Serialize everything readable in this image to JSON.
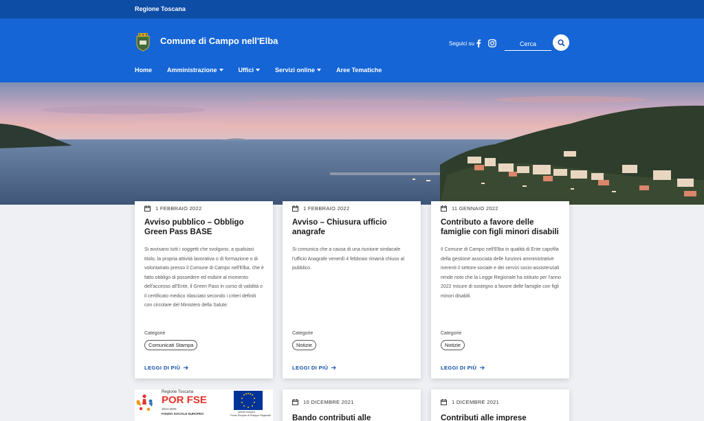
{
  "topbar": {
    "region": "Regione Toscana"
  },
  "header": {
    "title": "Comune di Campo nell'Elba",
    "follow_label": "Seguici su",
    "search_placeholder": "Cerca"
  },
  "nav": [
    {
      "label": "Home",
      "dropdown": false
    },
    {
      "label": "Amministrazione",
      "dropdown": true
    },
    {
      "label": "Uffici",
      "dropdown": true
    },
    {
      "label": "Servizi online",
      "dropdown": true
    },
    {
      "label": "Aree Tematiche",
      "dropdown": false
    }
  ],
  "cards": [
    {
      "date": "1 FEBBRAIO 2022",
      "title": "Avviso pubblico – Obbligo Green Pass BASE",
      "text": "Si avvisano tutti i soggetti che svolgono, a qualsiasi titolo, la propria attività lavorativa o di formazione o di volontariato presso il Comune di Campo nell'Elba, che è fatto obbligo di possedere ed esibire al momento dell'accesso all'Ente, il Green Pass in corso di validità o il certificato medico rilasciato secondo i criteri definiti con circolare del Ministero della Salute.",
      "category_label": "Categorie",
      "category": "Comunicati Stampa",
      "read_more": "LEGGI DI PIÙ"
    },
    {
      "date": "1 FEBBRAIO 2022",
      "title": "Avviso – Chiusura ufficio anagrafe",
      "text": "Si comunica che a causa di una riunione sindacale l'ufficio Anagrafe venerdì 4 febbraio rimarrà chiuso al pubblico.",
      "category_label": "Categorie",
      "category": "Notizie",
      "read_more": "LEGGI DI PIÙ"
    },
    {
      "date": "11 GENNAIO 2022",
      "title": "Contributo a favore delle famiglie con figli minori disabili",
      "text": "Il Comune di Campo nell'Elba in qualità di Ente capofila della gestione associata delle funzioni amministrative inerenti il settore sociale e dei servizi socio-assistenziali rende noto che la Legge Regionale ha istituito per l'anno 2022 misure di sostegno a favore delle famiglie con figli minori disabili.",
      "category_label": "Categorie",
      "category": "Notizie",
      "read_more": "LEGGI DI PIÙ"
    },
    {
      "date": "10 DICEMBRE 2021",
      "title": "Bando contributi alle"
    },
    {
      "date": "1 DICEMBRE 2021",
      "title": "Contributi alle imprese"
    }
  ],
  "banner": {
    "region": "Regione Toscana",
    "brand": "POR FSE",
    "years": "2014-2020",
    "fund": "FONDO SOCIALE EUROPEO",
    "eu_label": "Unione europea",
    "eu_fund": "Fondo Europeo di Sviluppo Regionale"
  },
  "colors": {
    "topbar": "#0d4da6",
    "header": "#1565d6",
    "link": "#0d4da6"
  }
}
